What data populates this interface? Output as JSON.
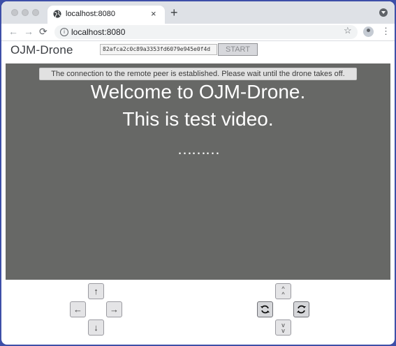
{
  "browser": {
    "tab_title": "localhost:8080",
    "tab_close": "×",
    "new_tab": "+",
    "url": "localhost:8080",
    "icons": {
      "back": "←",
      "forward": "→",
      "reload": "⟳",
      "info": "i",
      "star": "☆",
      "menu": "⋮"
    }
  },
  "app": {
    "title": "OJM-Drone",
    "peer_id_value": "82afca2c0c89a3353fd6079e945e0f4d",
    "start_label": "START"
  },
  "video": {
    "status_message": "The connection to the remote peer is established. Please wait until the drone takes off.",
    "line1": "Welcome to OJM-Drone.",
    "line2": "This is test video.",
    "line3": "………",
    "background": "#676866"
  },
  "controls": {
    "up": "↑",
    "left": "←",
    "right": "→",
    "down": "↓",
    "ascend": "^\n^",
    "descend": "v\nv"
  }
}
